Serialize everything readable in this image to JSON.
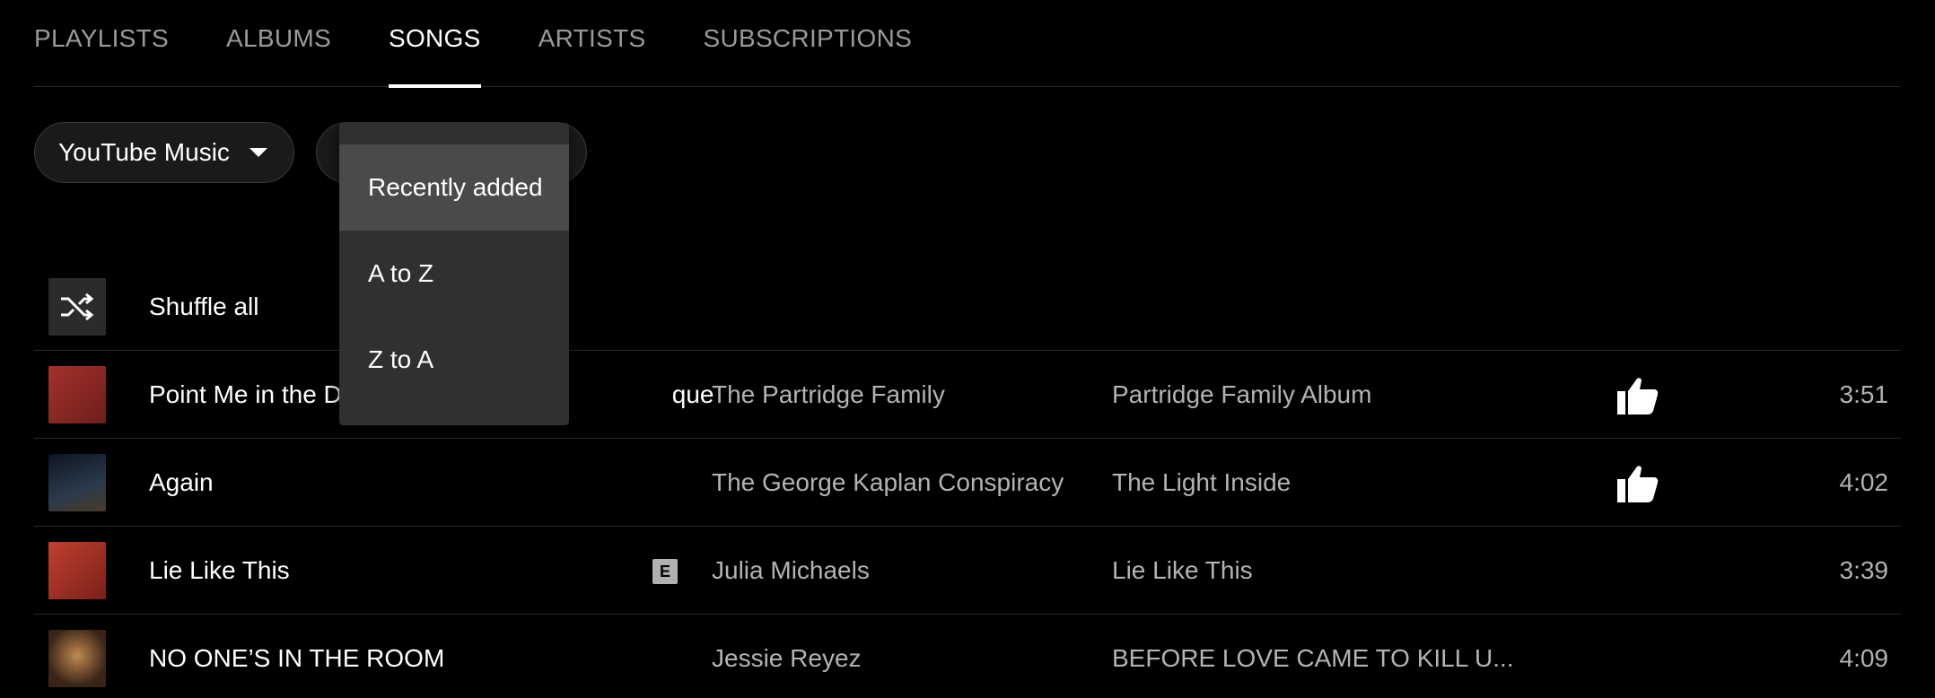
{
  "tabs": [
    {
      "label": "PLAYLISTS",
      "active": false
    },
    {
      "label": "ALBUMS",
      "active": false
    },
    {
      "label": "SONGS",
      "active": true
    },
    {
      "label": "ARTISTS",
      "active": false
    },
    {
      "label": "SUBSCRIPTIONS",
      "active": false
    }
  ],
  "filters": {
    "source_label": "YouTube Music",
    "sort_options": [
      "Recently added",
      "A to Z",
      "Z to A"
    ],
    "sort_selected": "Recently added"
  },
  "shuffle": {
    "label": "Shuffle all",
    "icon": "shuffle-icon"
  },
  "songs": [
    {
      "title": "Point Me in the D",
      "title_tail": "que",
      "artist": "The Partridge Family",
      "album": "Partridge Family Album",
      "liked": true,
      "explicit": false,
      "duration": "3:51",
      "thumb_color": "#8e2a26"
    },
    {
      "title": "Again",
      "artist": "The George Kaplan Conspiracy",
      "album": "The Light Inside",
      "liked": true,
      "explicit": false,
      "duration": "4:02",
      "thumb_color": "#1c2a3a"
    },
    {
      "title": "Lie Like This",
      "artist": "Julia Michaels",
      "album": "Lie Like This",
      "liked": false,
      "explicit": true,
      "explicit_label": "E",
      "duration": "3:39",
      "thumb_color": "#b23a2a"
    },
    {
      "title": "NO ONE’S IN THE ROOM",
      "artist": "Jessie Reyez",
      "album": "BEFORE LOVE CAME TO KILL U...",
      "liked": false,
      "explicit": false,
      "duration": "4:09",
      "thumb_color": "#3a2418"
    }
  ]
}
